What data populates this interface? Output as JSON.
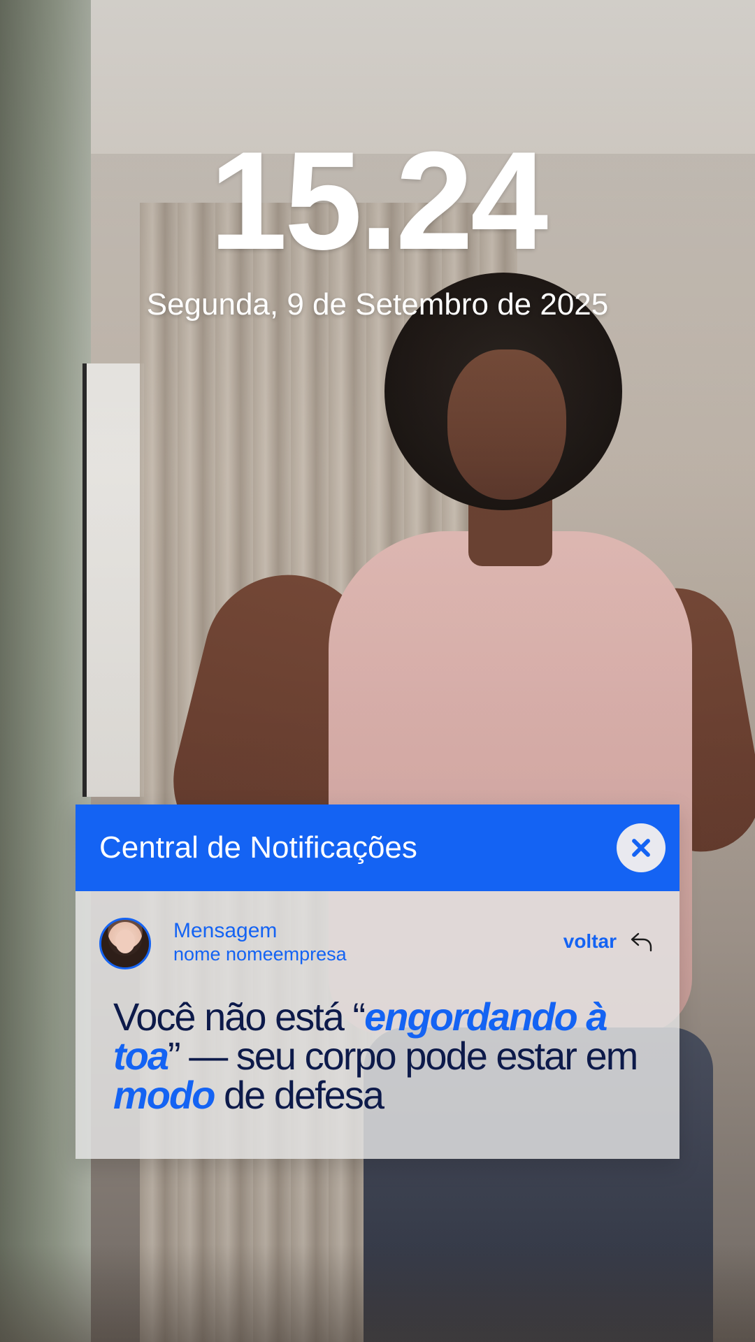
{
  "lockscreen": {
    "time": "15.24",
    "date": "Segunda, 9 de Setembro de 2025"
  },
  "notification_center": {
    "title": "Central de Notificações",
    "close_icon": "close-icon",
    "message": {
      "label": "Mensagem",
      "sender": "nome nomeempresa",
      "back_label": "voltar",
      "back_icon": "reply-arrow-icon",
      "headline": {
        "part1": "Você não está “",
        "emphasis1": "engordando à toa",
        "part2": "” — seu corpo pode estar em ",
        "emphasis2": "modo",
        "part3": " de defesa"
      }
    }
  },
  "colors": {
    "accent": "#1463f3",
    "headline_text": "#0d1a4a",
    "card_bg": "#e4e4e4"
  }
}
